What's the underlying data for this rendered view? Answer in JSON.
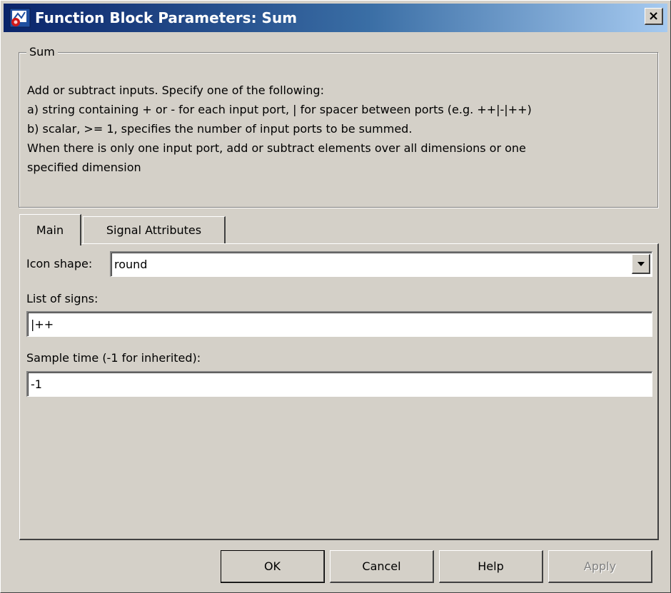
{
  "window": {
    "title": "Function Block Parameters: Sum",
    "close_label": "×"
  },
  "group": {
    "legend": "Sum",
    "description_lines": [
      "Add or subtract inputs.  Specify one of the following:",
      "a) string containing + or - for each input port, | for spacer between ports (e.g. ++|-|++)",
      "b) scalar, >= 1, specifies the number of input ports to be summed.",
      "When there is only one input port, add or subtract elements over all dimensions or one",
      "specified dimension"
    ]
  },
  "tabs": [
    {
      "label": "Main",
      "selected": true
    },
    {
      "label": "Signal Attributes",
      "selected": false
    }
  ],
  "main": {
    "icon_shape_label": "Icon shape:",
    "icon_shape_value": "round",
    "list_of_signs_label": "List of signs:",
    "list_of_signs_value": "|++",
    "sample_time_label": "Sample time (-1 for inherited):",
    "sample_time_value": "-1"
  },
  "buttons": {
    "ok": "OK",
    "cancel": "Cancel",
    "help": "Help",
    "apply": "Apply"
  },
  "colors": {
    "face": "#d4d0c8",
    "titlebar_start": "#0a246a",
    "titlebar_end": "#a6caf0"
  },
  "icons": {
    "app": "simulink-block-icon",
    "close": "close-icon",
    "dropdown": "triangle-down-icon"
  }
}
